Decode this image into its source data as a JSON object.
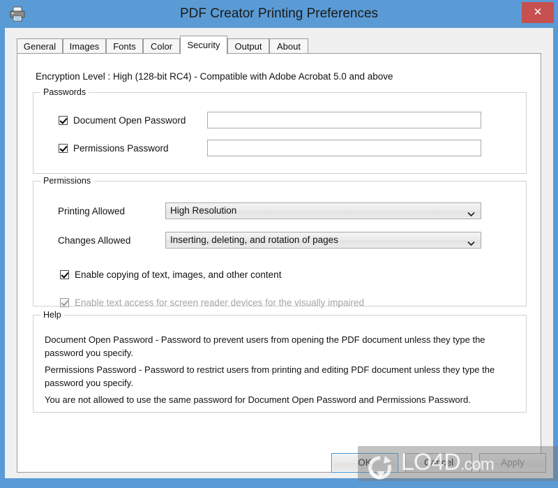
{
  "window": {
    "title": "PDF Creator Printing Preferences",
    "icon": "printer-icon",
    "close_label": "✕",
    "titlebar_color": "#5b9bd5",
    "close_color": "#c75050"
  },
  "tabs": [
    {
      "label": "General",
      "active": false
    },
    {
      "label": "Images",
      "active": false
    },
    {
      "label": "Fonts",
      "active": false
    },
    {
      "label": "Color",
      "active": false
    },
    {
      "label": "Security",
      "active": true
    },
    {
      "label": "Output",
      "active": false
    },
    {
      "label": "About",
      "active": false
    }
  ],
  "security": {
    "encryption_level": "Encryption Level : High (128-bit RC4) - Compatible with Adobe Acrobat 5.0 and above",
    "passwords": {
      "legend": "Passwords",
      "rows": [
        {
          "label": "Document Open Password",
          "checked": true,
          "value": "",
          "placeholder": ""
        },
        {
          "label": "Permissions Password",
          "checked": true,
          "value": "",
          "placeholder": ""
        }
      ]
    },
    "permissions": {
      "legend": "Permissions",
      "printing_label": "Printing Allowed",
      "printing_value": "High Resolution",
      "changes_label": "Changes Allowed",
      "changes_value": "Inserting, deleting, and rotation of pages",
      "copy_checkbox": {
        "label": "Enable copying of text, images, and other content",
        "checked": true,
        "disabled": false
      },
      "screenreader_checkbox": {
        "label": "Enable text access for screen reader devices for the visually impaired",
        "checked": true,
        "disabled": true
      }
    },
    "help": {
      "legend": "Help",
      "paragraphs": [
        "Document Open Password - Password to prevent users from opening the PDF document unless they type the password you specify.",
        "Permissions Password - Password to restrict users from printing and editing PDF document unless they type the password you specify.",
        "You are not allowed to use the same password for Document Open Password and Permissions Password."
      ]
    }
  },
  "footer": {
    "ok_label": "OK",
    "cancel_label": "Cancel",
    "apply_label": "Apply"
  },
  "watermark": {
    "text": "LO4D",
    "domain": ".com"
  }
}
